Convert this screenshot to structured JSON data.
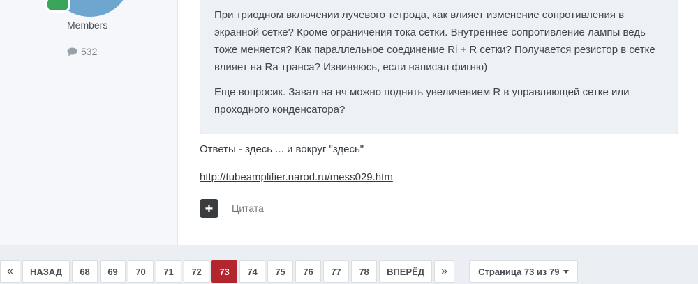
{
  "author": {
    "group": "Members",
    "post_count": "532",
    "post_count_icon": "comment-icon"
  },
  "post": {
    "quote_paragraphs": [
      "При триодном включении лучевого тетрода, как влияет изменение сопротивления в экранной сетке? Кроме ограничения тока сетки. Внутреннее сопротивление лампы ведь тоже меняется? Как параллельное соединение Ri + R сетки? Получается резистор в сетке влияет на Ra транса? Извиняюсь, если написал фигню)",
      "Еще вопросик. Завал на нч можно поднять увеличением R в управляющей сетке или проходного конденсатора?"
    ],
    "answer_text": "Ответы - здесь ... и вокруг \"здесь\"",
    "link_text": "http://tubeamplifier.narod.ru/mess029.htm",
    "quote_button_icon": "plus-icon",
    "quote_button_label": "Цитата"
  },
  "pagination": {
    "first": "«",
    "prev": "НАЗАД",
    "pages": [
      "68",
      "69",
      "70",
      "71",
      "72",
      "73",
      "74",
      "75",
      "76",
      "77",
      "78"
    ],
    "current_page": "73",
    "next": "ВПЕРЁД",
    "last": "»",
    "jump_label": "Страница 73 из 79",
    "jump_icon": "caret-down-icon"
  },
  "colors": {
    "active_page": "#b3262d",
    "avatar": "#6ea6cf",
    "rank_badge": "#3aa55a"
  }
}
